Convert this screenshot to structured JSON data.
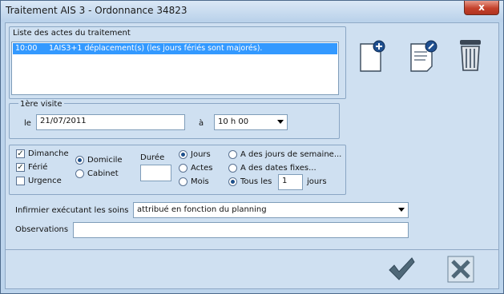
{
  "window": {
    "title": "Traitement AIS 3 - Ordonnance 34823",
    "close_label": "x"
  },
  "actes": {
    "legend": "Liste des actes du traitement",
    "rows": [
      {
        "time": "10:00",
        "text": "1AIS3+1 déplacement(s) (les jours fériés sont majorés)."
      }
    ]
  },
  "toolbar": {
    "add_icon": "add-document-icon",
    "edit_icon": "edit-document-icon",
    "delete_icon": "trash-icon"
  },
  "visite": {
    "legend": "1ère visite",
    "le_label": "le",
    "date": "21/07/2011",
    "a_label": "à",
    "time": "10 h 00"
  },
  "days": {
    "dimanche": {
      "label": "Dimanche",
      "checked": true
    },
    "ferie": {
      "label": "Férié",
      "checked": true
    },
    "urgence": {
      "label": "Urgence",
      "checked": false
    }
  },
  "lieu": {
    "domicile": {
      "label": "Domicile",
      "selected": true
    },
    "cabinet": {
      "label": "Cabinet",
      "selected": false
    }
  },
  "duree": {
    "label": "Durée",
    "value": ""
  },
  "unite": {
    "jours": {
      "label": "Jours",
      "selected": true
    },
    "actes": {
      "label": "Actes",
      "selected": false
    },
    "mois": {
      "label": "Mois",
      "selected": false
    }
  },
  "frequence": {
    "semaine": {
      "label": "A des jours de semaine...",
      "selected": false
    },
    "dates": {
      "label": "A des dates fixes...",
      "selected": false
    },
    "tous": {
      "label": "Tous les",
      "selected": true
    },
    "interval": "1",
    "jours_label": "jours"
  },
  "infirmier": {
    "label": "Infirmier exécutant les soins",
    "value": "attribué en fonction du planning"
  },
  "observations": {
    "label": "Observations",
    "value": ""
  },
  "buttons": {
    "ok_icon": "checkmark-icon",
    "cancel_icon": "x-icon"
  },
  "colors": {
    "selection": "#3399ff",
    "background": "#cfe0f1"
  }
}
